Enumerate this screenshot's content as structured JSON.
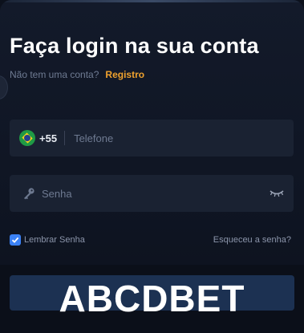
{
  "form": {
    "title": "Faça login na sua conta",
    "no_account_text": "Não tem uma conta?",
    "register_link": "Registro"
  },
  "phone_field": {
    "country_flag": "brazil-flag-icon",
    "country_code": "+55",
    "placeholder": "Telefone"
  },
  "password_field": {
    "icon": "key-icon",
    "placeholder": "Senha",
    "toggle_icon": "eye-closed-icon"
  },
  "remember": {
    "label": "Lembrar Senha",
    "checked": true
  },
  "forgot_link": "Esqueceu a senha?",
  "watermark": "ABCDBET",
  "colors": {
    "accent_link": "#f0a22e",
    "checkbox": "#3b82f6",
    "field_bg": "#1a2232",
    "button_bg": "#1c3152"
  }
}
